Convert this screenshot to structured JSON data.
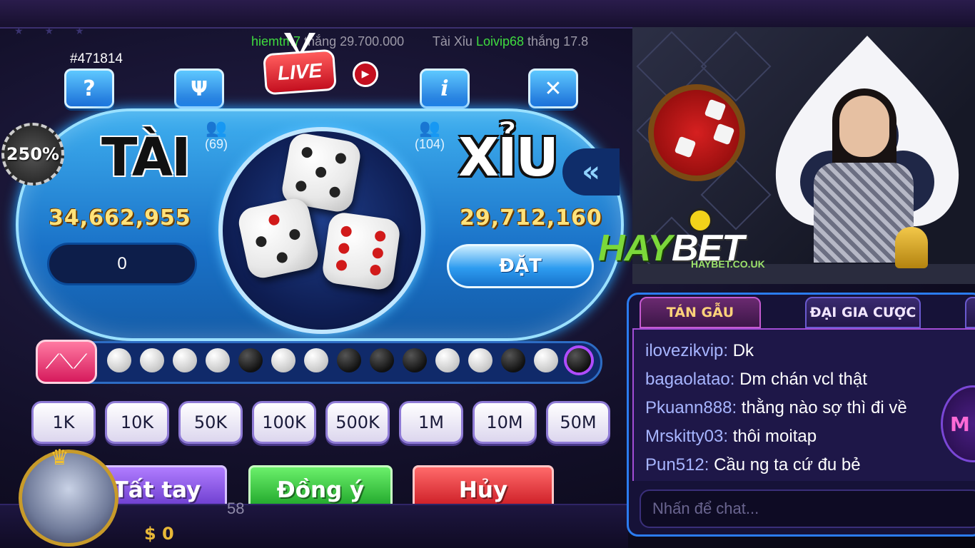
{
  "ticker": {
    "item1": {
      "user": "hiemtm7",
      "verb": "thắng",
      "amount": "29.700.000"
    },
    "item2": {
      "game": "Tài Xỉu",
      "user": "Loivip68",
      "verb": "thắng",
      "amount": "17.8"
    }
  },
  "session_id": "#471814",
  "header": {
    "help_glyph": "?",
    "info_glyph": "i",
    "live_label": "LIVE"
  },
  "bonus_badge": "250%",
  "tai": {
    "label": "TÀI",
    "players": "(69)",
    "total": "34,662,955",
    "bet_value": "0"
  },
  "xiu": {
    "label": "XỈU",
    "players": "(104)",
    "total": "29,712,160",
    "bet_button": "ĐẶT"
  },
  "collapse_glyph": "«",
  "history": [
    "white",
    "white",
    "white",
    "white",
    "black",
    "white",
    "white",
    "black",
    "black",
    "black",
    "white",
    "white",
    "black",
    "white",
    "black"
  ],
  "chips": [
    "1K",
    "10K",
    "50K",
    "100K",
    "500K",
    "1M",
    "10M",
    "50M"
  ],
  "actions": {
    "all_in": "Tất tay",
    "confirm": "Đồng ý",
    "cancel": "Hủy"
  },
  "player": {
    "balance": "$ 0",
    "partial_number": "58"
  },
  "brand": {
    "hay": "HAY",
    "bet": "BET",
    "url": "HAYBET.CO.UK"
  },
  "chat": {
    "tab_chat": "TÁN GẪU",
    "tab_rich": "ĐẠI GIA CƯỢC",
    "messages": [
      {
        "user": "ilovezikvip:",
        "text": "Dk"
      },
      {
        "user": "bagaolatao:",
        "text": "Dm chán vcl thật"
      },
      {
        "user": "Pkuann888:",
        "text": "thằng nào sợ thì đi về"
      },
      {
        "user": "Mrskitty03:",
        "text": "thôi moitap"
      },
      {
        "user": "Pun512:",
        "text": "Cầu ng ta cứ đu bẻ"
      }
    ],
    "input_placeholder": "Nhấn để chat..."
  },
  "mini_game_label": "M",
  "colors": {
    "accent": "#2aa4ff",
    "gold": "#ffe27a",
    "chat_user": "#a7b5ff"
  }
}
